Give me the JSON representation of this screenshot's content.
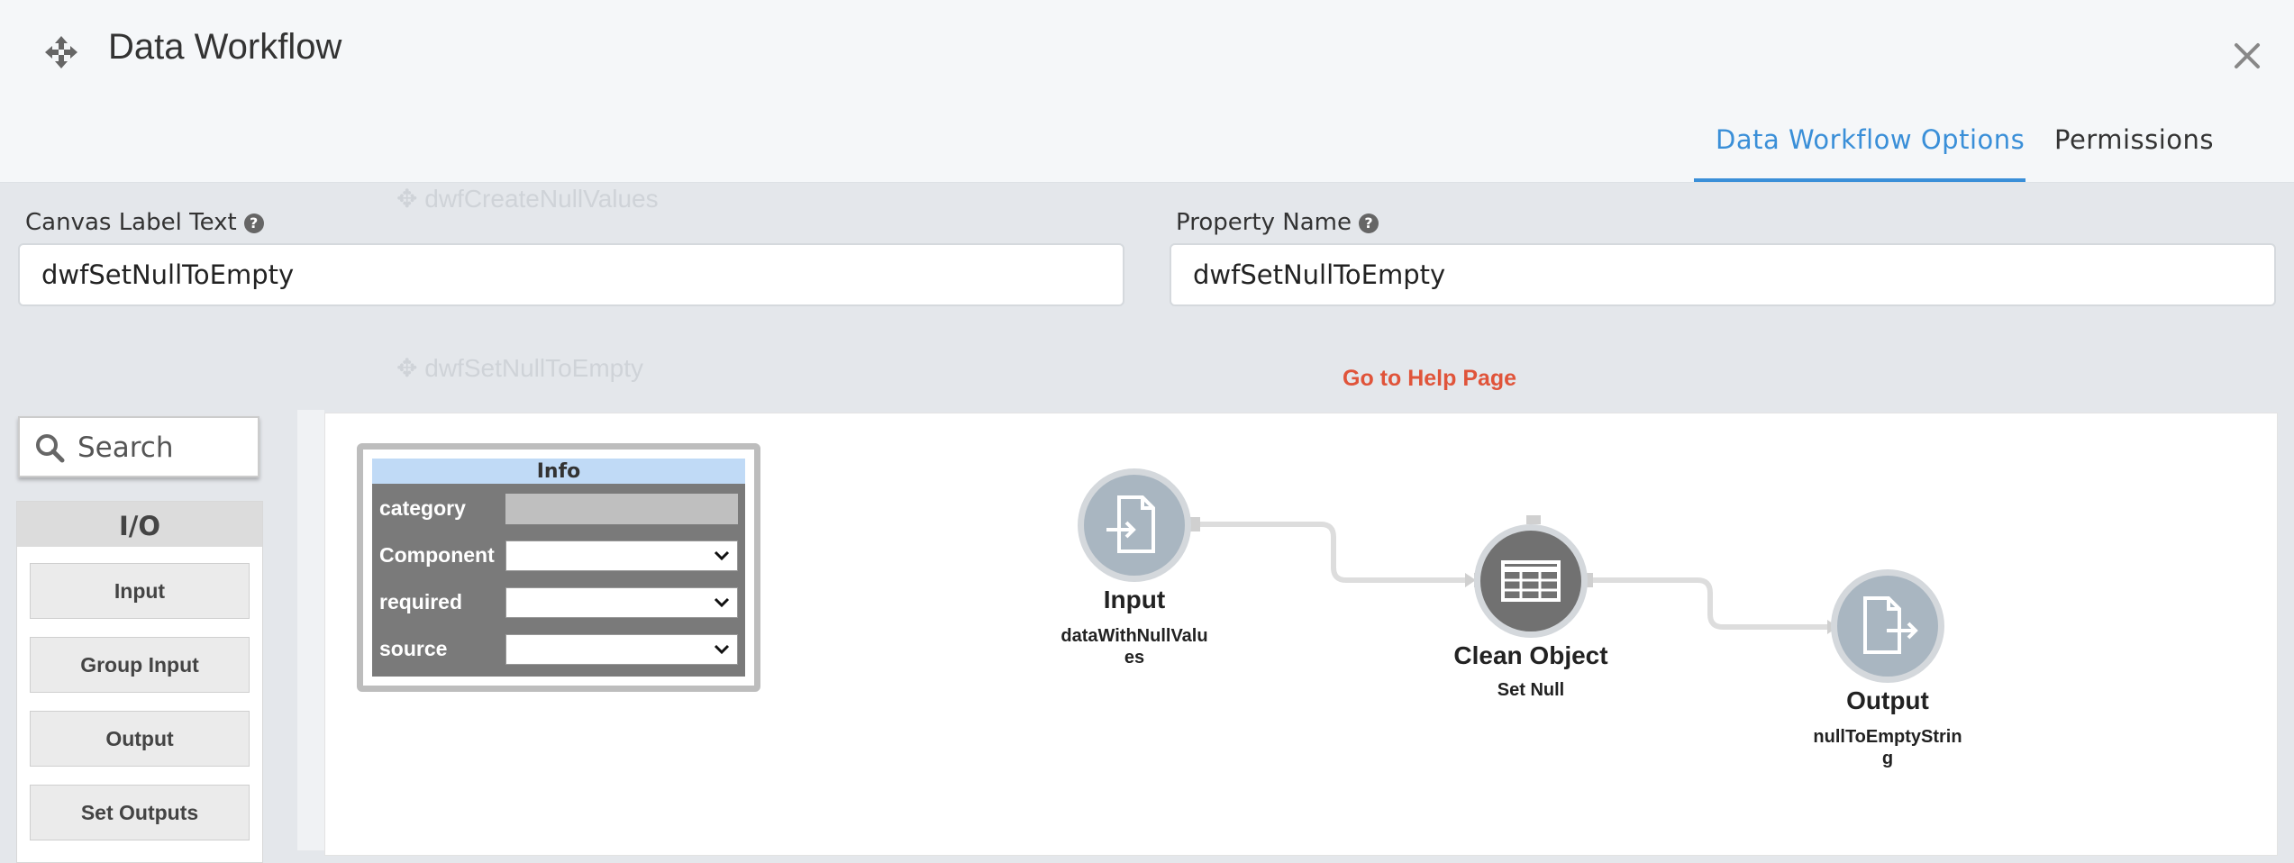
{
  "header": {
    "title": "Data Workflow",
    "tabs": [
      {
        "label": "Data Workflow Options",
        "active": true
      },
      {
        "label": "Permissions",
        "active": false
      }
    ]
  },
  "background_labels": [
    "dwfCreateNullValues",
    "dwfSetNullToEmpty"
  ],
  "form": {
    "canvas_label": {
      "label": "Canvas Label Text",
      "value": "dwfSetNullToEmpty"
    },
    "property_name": {
      "label": "Property Name",
      "value": "dwfSetNullToEmpty"
    },
    "help_link": "Go to Help Page"
  },
  "sidebar": {
    "search_placeholder": "Search",
    "group_title": "I/O",
    "items": [
      "Input",
      "Group Input",
      "Output",
      "Set Outputs"
    ]
  },
  "info_panel": {
    "title": "Info",
    "rows": [
      {
        "key": "category",
        "value": ""
      },
      {
        "key": "Component",
        "value": ""
      },
      {
        "key": "required",
        "value": ""
      },
      {
        "key": "source",
        "value": ""
      }
    ]
  },
  "nodes": [
    {
      "title": "Input",
      "subtitle": "dataWithNullValues",
      "icon": "file-import-icon",
      "color": "#a9b6c1"
    },
    {
      "title": "Clean Object",
      "subtitle": "Set Null",
      "icon": "table-icon",
      "color": "#717171"
    },
    {
      "title": "Output",
      "subtitle": "nullToEmptyString",
      "icon": "file-export-icon",
      "color": "#a9b6c1"
    }
  ],
  "colors": {
    "accent": "#3a8fd8",
    "help_link": "#e0543a",
    "info_header": "#c0daf6"
  }
}
